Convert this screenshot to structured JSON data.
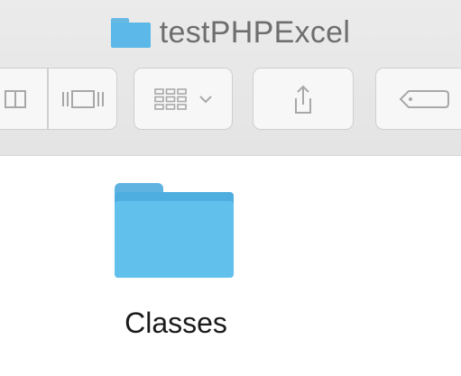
{
  "window": {
    "title": "testPHPExcel"
  },
  "toolbar": {
    "view_buttons": [
      "column-view",
      "cover-flow-view"
    ],
    "group_button": "arrange-menu",
    "share_button": "share",
    "tags_button": "tags"
  },
  "content": {
    "items": [
      {
        "name": "Classes",
        "icon": "folder-icon"
      }
    ]
  },
  "colors": {
    "folder": "#5bb8e8",
    "title_text": "#6e6e6e",
    "toolbar_bg": "#e8e8e8"
  }
}
